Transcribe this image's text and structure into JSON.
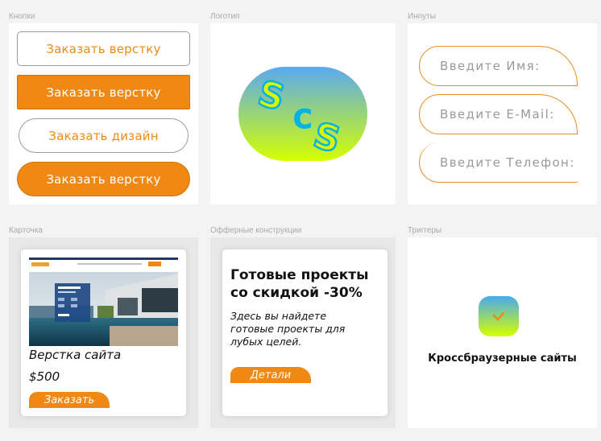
{
  "sections": {
    "buttons": "Кнопки",
    "logo": "Логотип",
    "inputs": "Инпуты",
    "card": "Карточка",
    "offer": "Офферные конструкции",
    "triggers": "Триггеры"
  },
  "buttons": [
    {
      "label": "Заказать верстку"
    },
    {
      "label": "Заказать верстку"
    },
    {
      "label": "Заказать дизайн"
    },
    {
      "label": "Заказать верстку"
    }
  ],
  "logo": {
    "letters": [
      "S",
      "C",
      "S"
    ]
  },
  "inputs": [
    {
      "placeholder": "Введите Имя:"
    },
    {
      "placeholder": "Введите E-Mail:"
    },
    {
      "placeholder": "Введите Телефон:"
    }
  ],
  "card": {
    "title": "Верстка сайта",
    "price": "$500",
    "button": "Заказать"
  },
  "offer": {
    "title_line1": "Готовые проекты",
    "title_line2": "со скидкой -30%",
    "desc_line1": "Здесь вы найдете",
    "desc_line2": "готовые проекты для",
    "desc_line3": "лубых целей.",
    "button": "Детали"
  },
  "trigger": {
    "label": "Кроссбраузерные сайты",
    "icon": "checkmark-icon"
  },
  "colors": {
    "accent": "#ef8913",
    "logo_green": "#d6ff00",
    "logo_blue": "#5aa9f0",
    "logo_letter": "#d9f500",
    "logo_letter_stroke": "#00b3e0"
  }
}
